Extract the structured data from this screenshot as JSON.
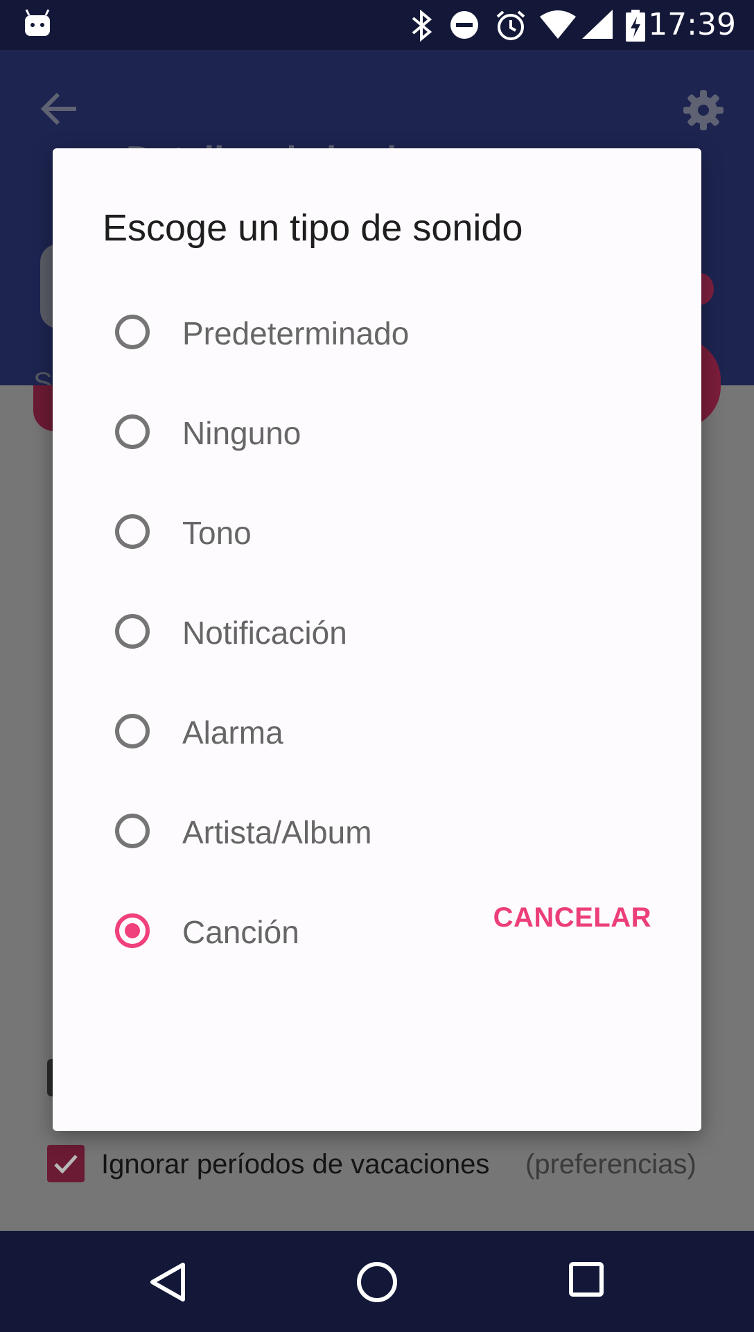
{
  "status_bar": {
    "time": "17:39",
    "icons": [
      "android-icon",
      "bluetooth-icon",
      "do-not-disturb-icon",
      "alarm-icon",
      "wifi-icon",
      "signal-icon",
      "battery-charging-icon"
    ]
  },
  "app_bar": {
    "title": "Detalles de la alarma",
    "back_icon": "arrow-back-icon",
    "settings_icon": "gear-icon",
    "partial_text": "S"
  },
  "background": {
    "checkbox_label": "Ignorar períodos de vacaciones",
    "checkbox_pref": "(preferencias)",
    "checkbox_checked": true
  },
  "dialog": {
    "title": "Escoge un tipo de sonido",
    "options": [
      {
        "label": "Predeterminado",
        "selected": false
      },
      {
        "label": "Ninguno",
        "selected": false
      },
      {
        "label": "Tono",
        "selected": false
      },
      {
        "label": "Notificación",
        "selected": false
      },
      {
        "label": "Alarma",
        "selected": false
      },
      {
        "label": "Artista/Album",
        "selected": false
      },
      {
        "label": "Canción",
        "selected": true
      }
    ],
    "cancel_label": "CANCELAR"
  },
  "nav_bar": {
    "buttons": [
      "back-triangle-icon",
      "home-circle-icon",
      "recents-square-icon"
    ]
  },
  "colors": {
    "accent": "#f0417c",
    "status_bar": "#141838",
    "nav_bar": "#131839"
  }
}
